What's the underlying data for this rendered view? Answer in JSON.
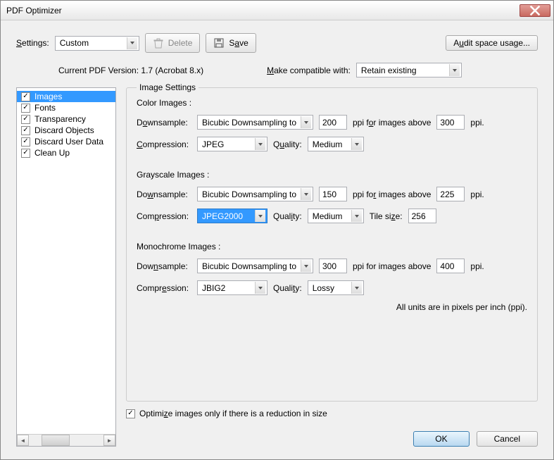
{
  "window": {
    "title": "PDF Optimizer"
  },
  "toolbar": {
    "settings_label": "Settings:",
    "settings_value": "Custom",
    "delete_label": "Delete",
    "save_label": "Save",
    "audit_label": "Audit space usage..."
  },
  "version": {
    "current_label": "Current PDF Version:",
    "current_value": "1.7 (Acrobat 8.x)",
    "compat_label": "Make compatible with:",
    "compat_value": "Retain existing"
  },
  "sidebar": {
    "items": [
      {
        "label": "Images",
        "checked": true,
        "active": true
      },
      {
        "label": "Fonts",
        "checked": true,
        "active": false
      },
      {
        "label": "Transparency",
        "checked": true,
        "active": false
      },
      {
        "label": "Discard Objects",
        "checked": true,
        "active": false
      },
      {
        "label": "Discard User Data",
        "checked": true,
        "active": false
      },
      {
        "label": "Clean Up",
        "checked": true,
        "active": false
      }
    ]
  },
  "panel": {
    "title": "Image Settings",
    "color": {
      "title": "Color Images :",
      "downsample_label": "Downsample:",
      "downsample_value": "Bicubic Downsampling to",
      "ppi": "200",
      "above_label": "ppi for images above",
      "above_ppi": "300",
      "ppi_unit": "ppi.",
      "compression_label": "Compression:",
      "compression_value": "JPEG",
      "quality_label": "Quality:",
      "quality_value": "Medium"
    },
    "gray": {
      "title": "Grayscale Images :",
      "downsample_label": "Downsample:",
      "downsample_value": "Bicubic Downsampling to",
      "ppi": "150",
      "above_label": "ppi for images above",
      "above_ppi": "225",
      "ppi_unit": "ppi.",
      "compression_label": "Compression:",
      "compression_value": "JPEG2000",
      "quality_label": "Quality:",
      "quality_value": "Medium",
      "tile_label": "Tile size:",
      "tile_value": "256"
    },
    "mono": {
      "title": "Monochrome Images :",
      "downsample_label": "Downsample:",
      "downsample_value": "Bicubic Downsampling to",
      "ppi": "300",
      "above_label": "ppi for images above",
      "above_ppi": "400",
      "ppi_unit": "ppi.",
      "compression_label": "Compression:",
      "compression_value": "JBIG2",
      "quality_label": "Quality:",
      "quality_value": "Lossy"
    },
    "note": "All units are in pixels per inch (ppi)."
  },
  "optimize_checkbox": {
    "checked": true,
    "label": "Optimize images only if there is a reduction in size"
  },
  "footer": {
    "ok": "OK",
    "cancel": "Cancel"
  }
}
